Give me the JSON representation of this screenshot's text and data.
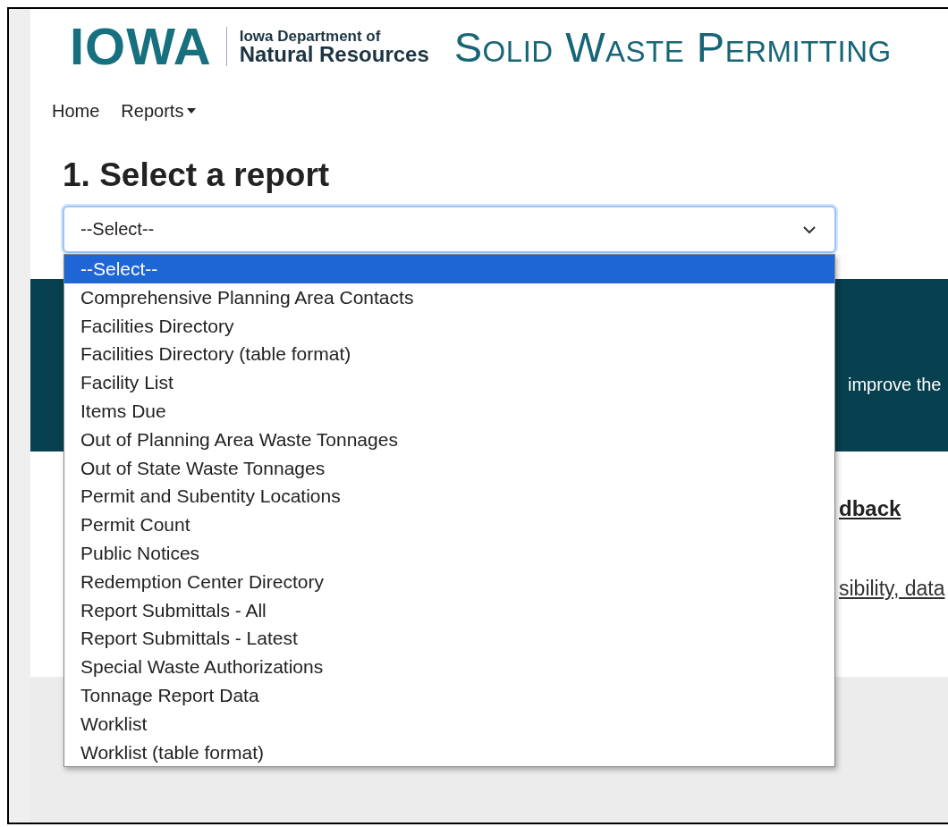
{
  "header": {
    "logo_text": "IOWA",
    "department_line_1": "Iowa Department of",
    "department_line_2": "Natural Resources",
    "title": "Solid Waste Permitting"
  },
  "nav": [
    {
      "label": "Home",
      "kind": "link"
    },
    {
      "label": "Reports",
      "kind": "dropdown"
    }
  ],
  "heading": "1. Select a report",
  "report_select": {
    "value": "--Select--",
    "expanded": true,
    "options": [
      {
        "label": "--Select--",
        "selected": true
      },
      {
        "label": "Comprehensive Planning Area Contacts",
        "selected": false
      },
      {
        "label": "Facilities Directory",
        "selected": false
      },
      {
        "label": "Facilities Directory (table format)",
        "selected": false
      },
      {
        "label": "Facility List",
        "selected": false
      },
      {
        "label": "Items Due",
        "selected": false
      },
      {
        "label": "Out of Planning Area Waste Tonnages",
        "selected": false
      },
      {
        "label": "Out of State Waste Tonnages",
        "selected": false
      },
      {
        "label": "Permit and Subentity Locations",
        "selected": false
      },
      {
        "label": "Permit Count",
        "selected": false
      },
      {
        "label": "Public Notices",
        "selected": false
      },
      {
        "label": "Redemption Center Directory",
        "selected": false
      },
      {
        "label": "Report Submittals - All",
        "selected": false
      },
      {
        "label": "Report Submittals - Latest",
        "selected": false
      },
      {
        "label": "Special Waste Authorizations",
        "selected": false
      },
      {
        "label": "Tonnage Report Data",
        "selected": false
      },
      {
        "label": "Worklist",
        "selected": false
      },
      {
        "label": "Worklist (table format)",
        "selected": false
      }
    ]
  },
  "banner": {
    "text": "improve the"
  },
  "feedback": {
    "heading": "dback",
    "link": "sibility, data"
  }
}
